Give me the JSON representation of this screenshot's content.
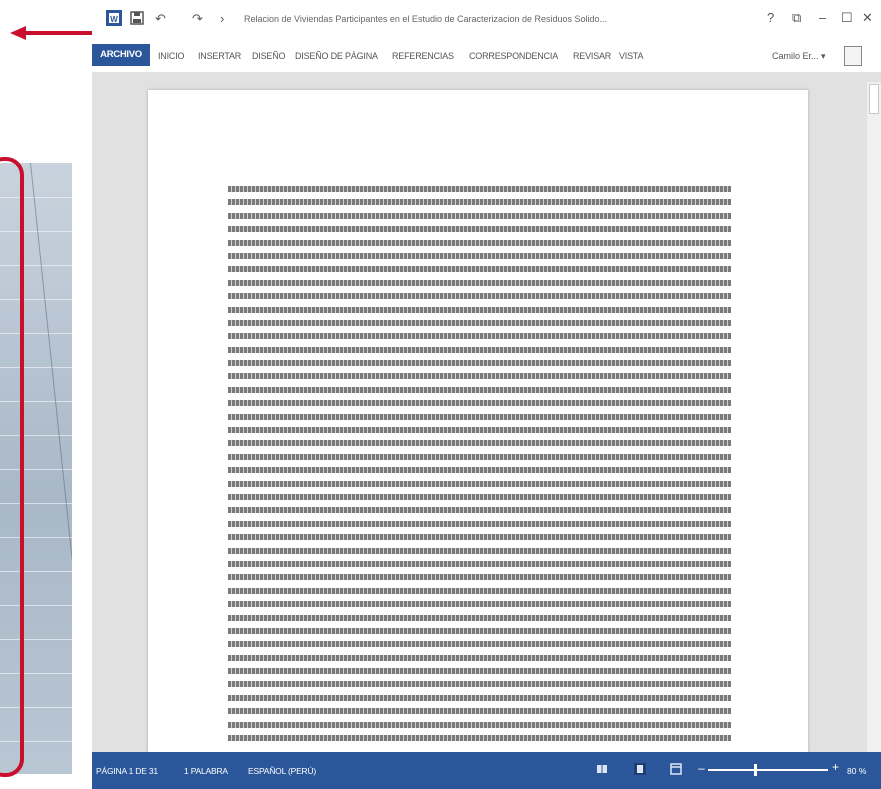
{
  "window": {
    "title": "Relacion de Viviendas Participantes en el Estudio de Caracterizacion de Residuos Solido...",
    "help": "?",
    "restore": "⧉",
    "minimize": "–",
    "maximize": "☐",
    "close": "✕"
  },
  "quick_access": {
    "undo": "↶",
    "redo": "↷",
    "more": "›"
  },
  "ribbon": {
    "tabs": [
      "ARCHIVO",
      "INICIO",
      "INSERTAR",
      "DISEÑO",
      "DISEÑO DE PÁGINA",
      "REFERENCIAS",
      "CORRESPONDENCIA",
      "REVISAR",
      "VISTA"
    ],
    "user": "Camilo Er... ▾"
  },
  "document": {
    "line_count": 42
  },
  "status_bar": {
    "page": "PÁGINA 1 DE 31",
    "words": "1 PALABRA",
    "language": "ESPAÑOL (PERÚ)",
    "zoom_minus": "–",
    "zoom_plus": "+",
    "zoom_level": "80 %",
    "zoom_percent": 80
  },
  "colors": {
    "accent": "#2b579a",
    "highlight": "#c8102e"
  }
}
